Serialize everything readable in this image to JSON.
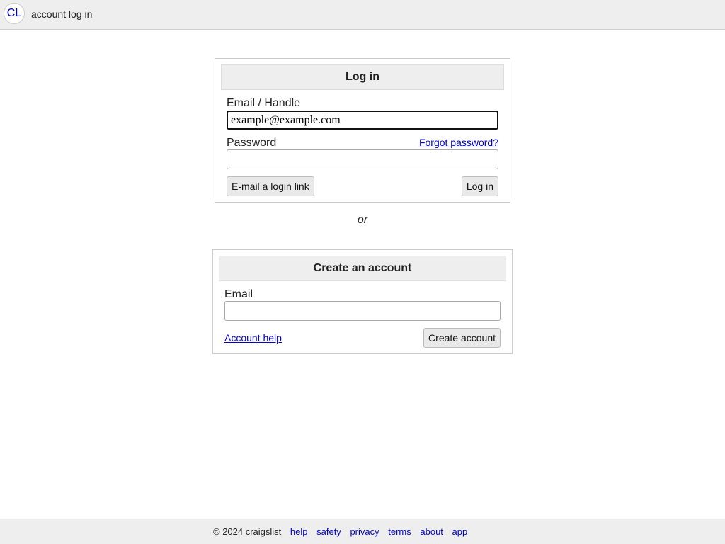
{
  "header": {
    "logo_text": "CL",
    "title": "account log in"
  },
  "login": {
    "heading": "Log in",
    "email_label": "Email / Handle",
    "email_value": "example@example.com",
    "password_label": "Password",
    "password_value": "",
    "forgot_link": "Forgot password?",
    "email_link_button": "E-mail a login link",
    "login_button": "Log in"
  },
  "separator": "or",
  "signup": {
    "heading": "Create an account",
    "email_label": "Email",
    "email_value": "",
    "help_link": "Account help",
    "create_button": "Create account"
  },
  "footer": {
    "copyright": "© 2024 craigslist",
    "links": [
      "help",
      "safety",
      "privacy",
      "terms",
      "about",
      "app"
    ]
  },
  "colors": {
    "link": "#0000cc",
    "header_bg": "#eeeeee",
    "button_bg": "#e9e9e9"
  }
}
